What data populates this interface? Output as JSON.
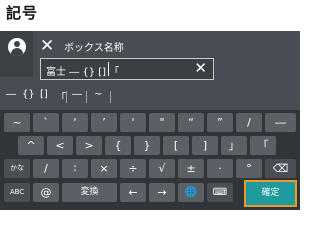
{
  "page": {
    "title": "記号"
  },
  "dialog": {
    "title": "ボックス名称",
    "close_icon": "✕"
  },
  "input": {
    "value": "富士 ― {} [] 「",
    "clear_icon": "✕"
  },
  "suggestions": [
    "―",
    "{}",
    "[]",
    "「",
    "―",
    "~"
  ],
  "keyboard": {
    "row1": [
      "~",
      "`",
      "‘",
      "’",
      "'",
      "\"",
      "“",
      "”",
      "/",
      "―"
    ],
    "row2": [
      "^",
      "<",
      ">",
      "{",
      "}",
      "[",
      "]",
      "」",
      "「"
    ],
    "row3": [
      "/",
      "∶",
      "×",
      "÷",
      "√",
      "±",
      "·",
      "°"
    ],
    "row4": {
      "abc": "ABC",
      "at": "@",
      "convert": "変換",
      "left_arrow": "←",
      "right_arrow": "→",
      "globe_icon": "🌐",
      "keyboard_icon": "⌨",
      "confirm": "確定"
    },
    "backspace_icon": "⌫",
    "kana_icon": "かな",
    "space_label": ""
  },
  "colors": {
    "confirm_bg": "#1f9a9d",
    "confirm_border": "#e89b2e"
  }
}
